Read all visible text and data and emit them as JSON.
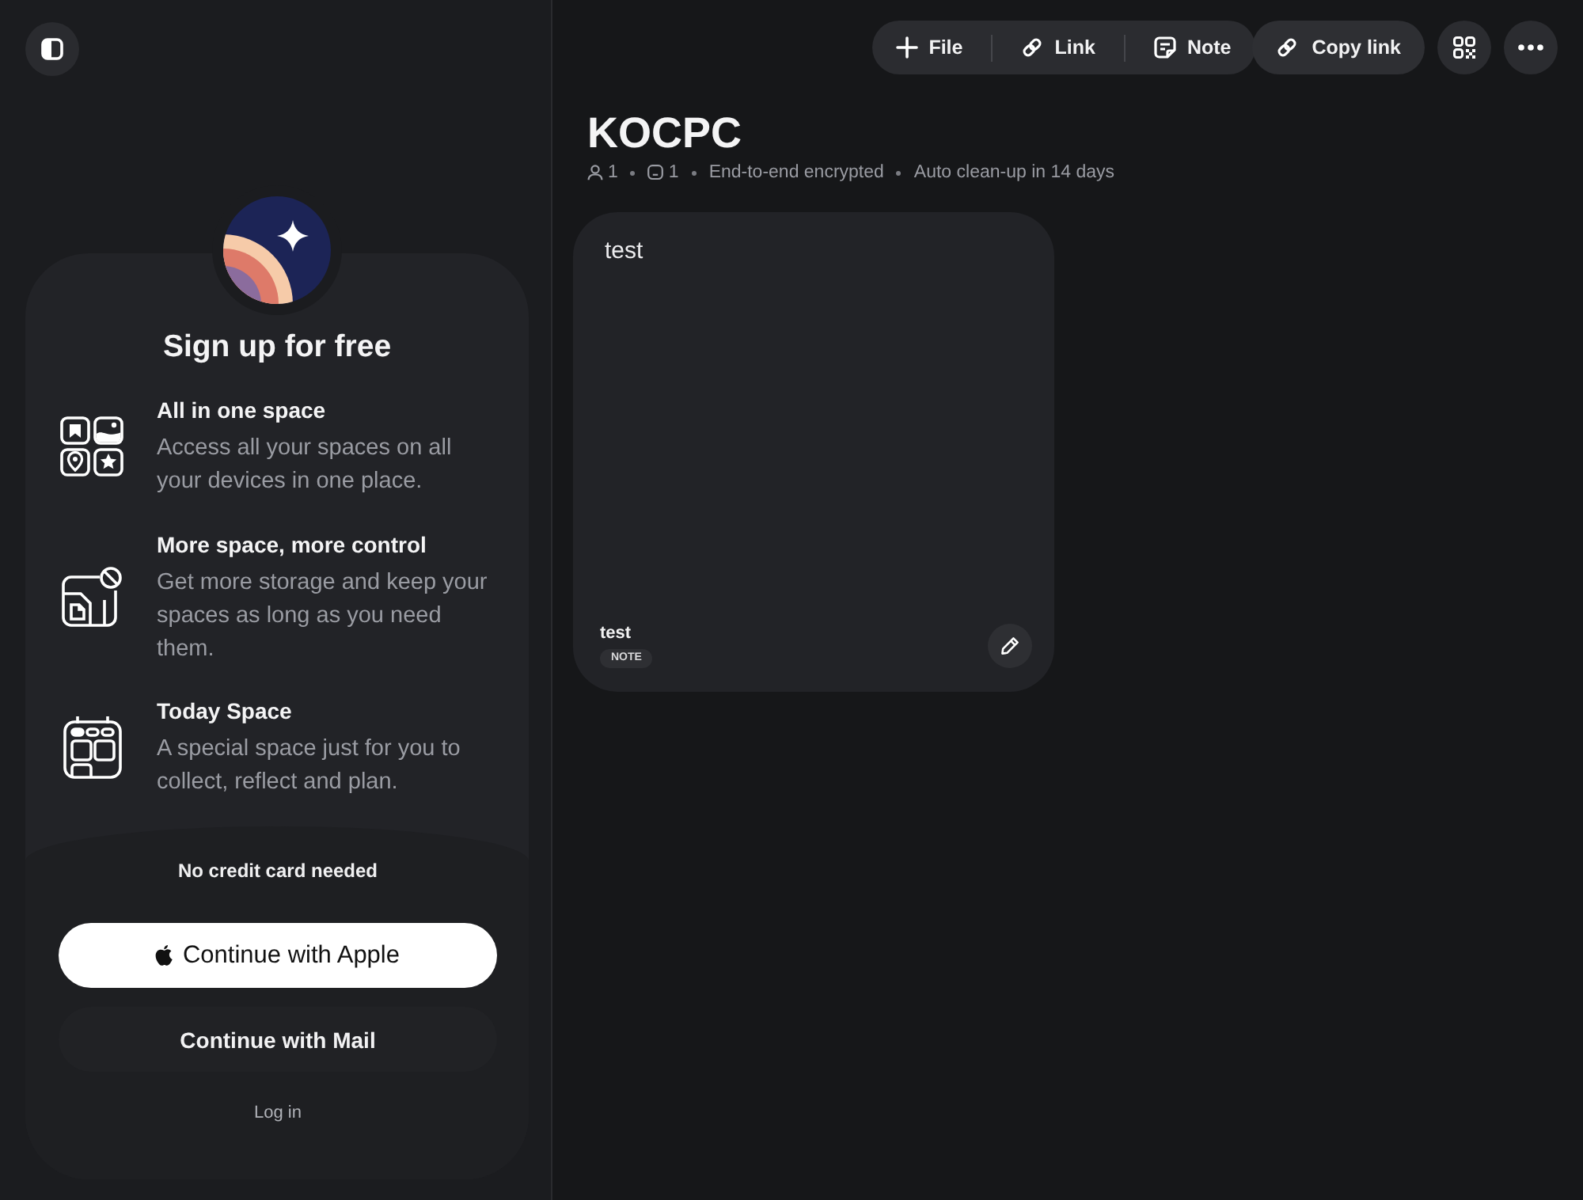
{
  "sidebar": {
    "signup": {
      "title": "Sign up for free",
      "features": [
        {
          "kind": "spaces",
          "title": "All in one space",
          "description": "Access all your spaces on all your devices in one place."
        },
        {
          "kind": "storage",
          "title": "More space, more control",
          "description": "Get more storage and keep your spaces as long as you need them."
        },
        {
          "kind": "today",
          "title": "Today Space",
          "description": "A special space just for you to collect, reflect and plan."
        }
      ],
      "note": "No credit card needed",
      "buttons": [
        {
          "kind": "apple",
          "label": "Continue with Apple"
        },
        {
          "kind": "mail",
          "label": "Continue with Mail"
        }
      ],
      "login": "Log in"
    }
  },
  "toolbar": {
    "add": [
      {
        "kind": "file",
        "label": "File"
      },
      {
        "kind": "link",
        "label": "Link"
      },
      {
        "kind": "note",
        "label": "Note"
      }
    ],
    "copy_link": "Copy link"
  },
  "space": {
    "title": "KOCPC",
    "meta": [
      {
        "kind": "members",
        "text": "1"
      },
      {
        "kind": "comments",
        "text": "1"
      },
      {
        "kind": "info",
        "text": "End-to-end encrypted"
      },
      {
        "kind": "info",
        "text": "Auto clean-up in 14 days"
      }
    ]
  },
  "cards": [
    {
      "content": "test",
      "title": "test",
      "badge": "NOTE"
    }
  ]
}
